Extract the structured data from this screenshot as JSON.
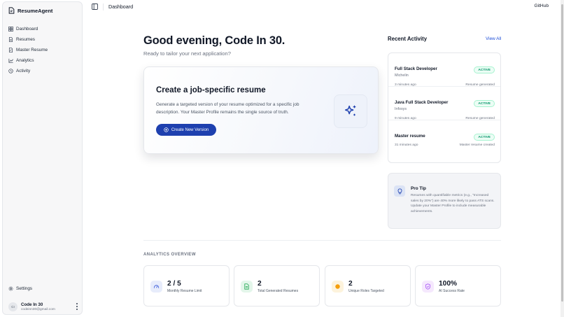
{
  "sidebar": {
    "brand": "ResumeAgent",
    "items": [
      {
        "label": "Dashboard",
        "icon": "grid-icon"
      },
      {
        "label": "Resumes",
        "icon": "file-icon"
      },
      {
        "label": "Master Resume",
        "icon": "edit-file-icon"
      },
      {
        "label": "Analytics",
        "icon": "chart-icon"
      },
      {
        "label": "Activity",
        "icon": "history-icon"
      }
    ],
    "settings_label": "Settings",
    "user": {
      "initials": "CI",
      "name": "Code In 30",
      "email": "codeinn30@gmail.com"
    }
  },
  "topbar": {
    "breadcrumb": "Dashboard",
    "github_label": "GitHub"
  },
  "main": {
    "greeting": "Good evening, Code In 30.",
    "subgreeting": "Ready to tailor your next application?",
    "hero": {
      "title": "Create a job-specific resume",
      "description": "Generate a targeted version of your resume optimized for a specific job description. Your Master Profile remains the single source of truth.",
      "button_label": "Create New Version"
    }
  },
  "recent_activity": {
    "title": "Recent Activity",
    "view_all": "View All",
    "items": [
      {
        "role": "Full Stack Developer",
        "company": "Michelin",
        "status": "ACTIVE",
        "time": "3 minutes ago",
        "action": "Resume generated"
      },
      {
        "role": "Java Full Stack Developer",
        "company": "Infosys",
        "status": "ACTIVE",
        "time": "9 minutes ago",
        "action": "Resume generated"
      },
      {
        "role": "Master resume",
        "company": "",
        "status": "ACTIVE",
        "time": "31 minutes ago",
        "action": "Master resume created"
      }
    ]
  },
  "pro_tip": {
    "title": "Pro Tip",
    "text": "Resumes with quantifiable metrics (e.g., \"Increased sales by 20%\") are 40% more likely to pass ATS scans. Update your Master Profile to include measurable achievements."
  },
  "analytics": {
    "title": "ANALYTICS OVERVIEW",
    "stats": [
      {
        "value": "2 / 5",
        "label": "Monthly Resume Limit",
        "icon": "gauge-icon",
        "color": "#3b5bdb"
      },
      {
        "value": "2",
        "label": "Total Generated Resumes",
        "icon": "document-icon",
        "color": "#16a34a"
      },
      {
        "value": "2",
        "label": "Unique Roles Targeted",
        "icon": "target-icon",
        "color": "#f59e0b"
      },
      {
        "value": "100%",
        "label": "AI Success Rate",
        "icon": "shield-check-icon",
        "color": "#a855f7"
      }
    ]
  },
  "colors": {
    "accent": "#1e40af",
    "link": "#1d4ed8",
    "active_badge": "#059669"
  }
}
